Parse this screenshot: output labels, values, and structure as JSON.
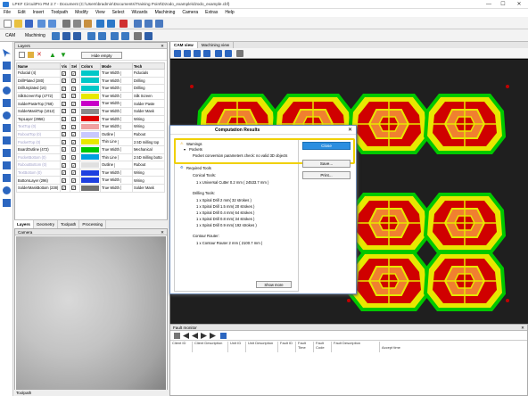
{
  "titlebar": {
    "title": "LPKF CircuitPro PM 2.7 - Document (C:\\Users\\bradmin\\Documents\\Training Point\\Dzodo_example\\dzodo_example.cbf)",
    "minimize": "—",
    "maximize": "☐",
    "close": "✕"
  },
  "menu": [
    "File",
    "Edit",
    "Insert",
    "Toolpath",
    "Modify",
    "View",
    "Select",
    "Wizards",
    "Machining",
    "Camera",
    "Extras",
    "Help"
  ],
  "toolbar2": {
    "cam_label": "CAM",
    "machining_label": "Machining"
  },
  "layers_panel": {
    "title": "Layers",
    "hide_empty": "Hide empty",
    "columns": [
      "Name",
      "Vis",
      "Sel",
      "Colors",
      "Mode",
      "Tech"
    ],
    "rows": [
      {
        "name": "Fiducial (4)",
        "color": "#00c8c8",
        "mode": "True Width",
        "tech": "Fiducials",
        "dim": false
      },
      {
        "name": "DrillPlated (280)",
        "color": "#00c8c8",
        "mode": "True Width",
        "tech": "Drilling",
        "dim": false
      },
      {
        "name": "DrillUnplated (16)",
        "color": "#00c8c8",
        "mode": "True Width",
        "tech": "Drilling",
        "dim": false
      },
      {
        "name": "SilkScreenTop (4772)",
        "color": "#e8e800",
        "mode": "True Width",
        "tech": "Silk Screen",
        "dim": false
      },
      {
        "name": "SolderPasteTop (768)",
        "color": "#c800c8",
        "mode": "True Width",
        "tech": "Solder Paste",
        "dim": false
      },
      {
        "name": "SolderMaskTop (1012)",
        "color": "#8a8a8a",
        "mode": "True Width",
        "tech": "Solder Mask",
        "dim": false
      },
      {
        "name": "TopLayer (2956)",
        "color": "#e00000",
        "mode": "True Width",
        "tech": "Wiring",
        "dim": false
      },
      {
        "name": "TextTop (0)",
        "color": "#f0a0a0",
        "mode": "True Width",
        "tech": "Wiring",
        "dim": true
      },
      {
        "name": "RuboutTop (0)",
        "color": "#c8c8ff",
        "mode": "Outline",
        "tech": "Rubout",
        "dim": true
      },
      {
        "name": "PocketTop (0)",
        "color": "#e8e800",
        "mode": "Thin Line",
        "tech": "2.5D milling top",
        "dim": true
      },
      {
        "name": "BoardOutline (472)",
        "color": "#00c800",
        "mode": "True Width",
        "tech": "Mechanical",
        "dim": false
      },
      {
        "name": "PocketBottom (0)",
        "color": "#00a0e0",
        "mode": "Thin Line",
        "tech": "2.5D milling botto",
        "dim": true
      },
      {
        "name": "RuboutBottom (0)",
        "color": "#e0e0e0",
        "mode": "Outline",
        "tech": "Rubout",
        "dim": true
      },
      {
        "name": "TextBottom (0)",
        "color": "#1e40e0",
        "mode": "True Width",
        "tech": "Wiring",
        "dim": true
      },
      {
        "name": "BottomLayer (296)",
        "color": "#1e40e0",
        "mode": "True Width",
        "tech": "Wiring",
        "dim": false
      },
      {
        "name": "SolderMaskBottom (238)",
        "color": "#707070",
        "mode": "True Width",
        "tech": "Solder Mask",
        "dim": false
      }
    ],
    "tabs": [
      "Layers",
      "Geometry",
      "Toolpath",
      "Processing"
    ]
  },
  "camera_panel": {
    "title": "Camera"
  },
  "view": {
    "tabs": [
      "CAM view",
      "Machining view"
    ]
  },
  "dialog": {
    "title": "Computation Results",
    "warnings": "Warnings",
    "pockets": "Pockets",
    "pocket_msg": "Pocket conversion parameters check: no valid 3D objects",
    "required_tools": "Required Tools",
    "conical": "Conical Tools:",
    "conical_1": "1 x Universal Cutter 0.2 mm ( 24533.7 mm )",
    "drilling": "Drilling Tools:",
    "drill_1": "1 x Spiral Drill  2 mm( 32 strokes )",
    "drill_2": "1 x Spiral Drill  1.5 mm( 20 strokes )",
    "drill_3": "1 x Spiral Drill  0.4 mm( 64 strokes )",
    "drill_4": "1 x Spiral Drill  0.8 mm( 34 strokes )",
    "drill_5": "1 x Spiral Drill  0.9 mm( 192 strokes )",
    "contour": "Contour Router:",
    "contour_1": "1 x Contour Router 2 mm ( 2100.7 mm )",
    "close": "Close",
    "save": "Save...",
    "print": "Print...",
    "show_more": "Show more"
  },
  "fault_monitor": {
    "title": "Fault monitor",
    "columns": [
      "Client ID",
      "Client Description",
      "Unit ID",
      "Unit Description",
      "Fault ID",
      "Fault Time",
      "Fault Code",
      "Fault Description",
      "Accept time"
    ]
  },
  "status": "Toolpath"
}
